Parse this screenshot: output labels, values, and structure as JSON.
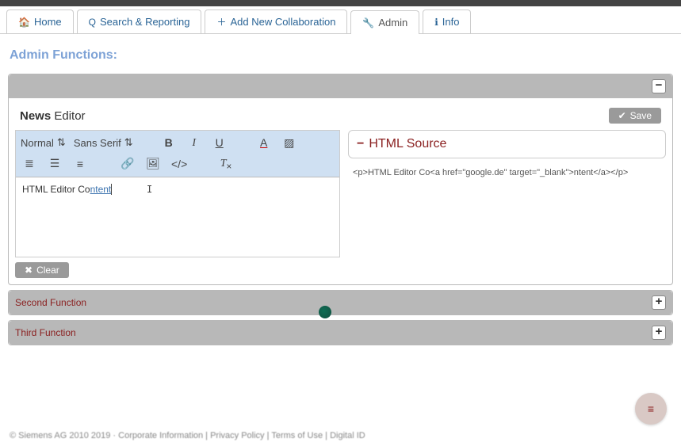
{
  "nav": {
    "home": "Home",
    "search": "Search & Reporting",
    "add": "Add New Collaboration",
    "admin": "Admin",
    "info": "Info"
  },
  "page": {
    "title": "Admin Functions:"
  },
  "newsPanel": {
    "label_bold": "News",
    "label_rest": " Editor",
    "save": "Save",
    "clear": "Clear"
  },
  "toolbar": {
    "style": "Normal",
    "font": "Sans Serif"
  },
  "editor": {
    "plain": "HTML Editor Co",
    "linked": "ntent"
  },
  "source": {
    "title": "HTML Source",
    "code": "<p>HTML Editor Co<a href=\"google.de\" target=\"_blank\">ntent</a></p>"
  },
  "sections": {
    "second": "Second Function",
    "third": "Third Function"
  },
  "footer": "© Siemens AG 2010 2019 · Corporate Information | Privacy Policy | Terms of Use | Digital ID"
}
